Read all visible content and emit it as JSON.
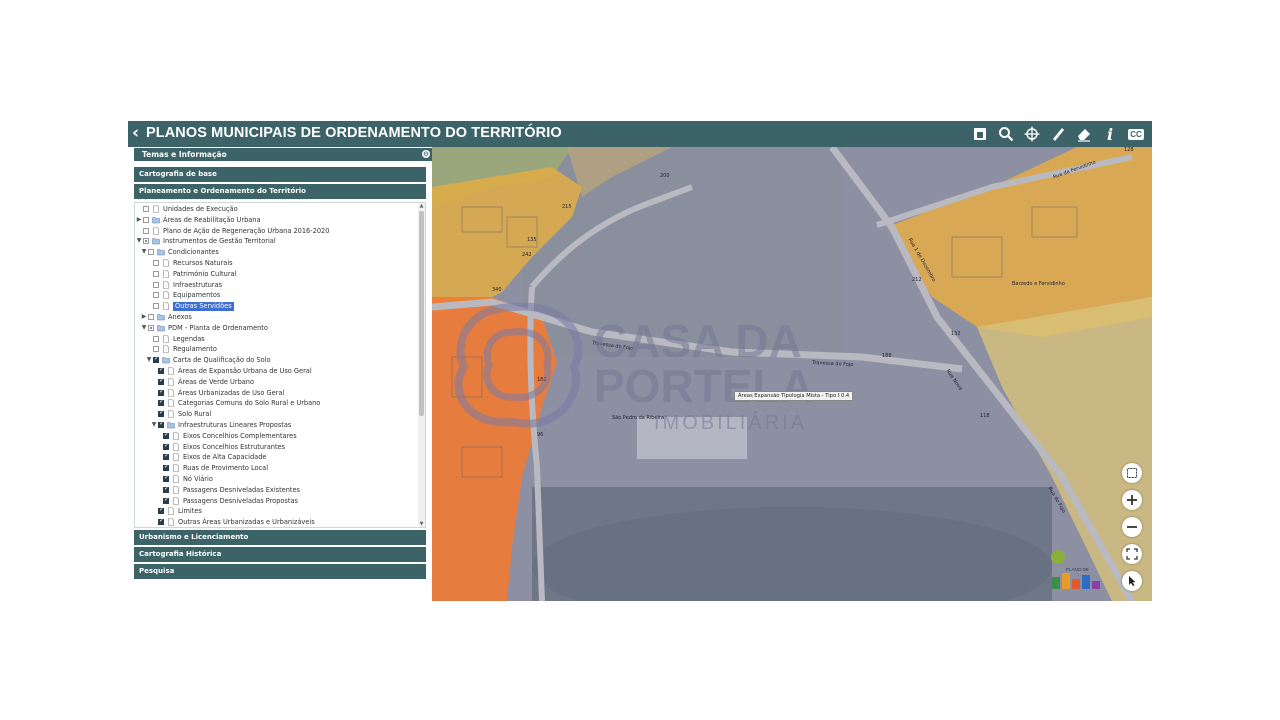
{
  "app": {
    "title": "PLANOS MUNICIPAIS DE ORDENAMENTO DO TERRITÓRIO",
    "back_icon": "chevron-left-icon",
    "accent_color": "#3c6468"
  },
  "toolbar": {
    "tools": [
      {
        "name": "select-area-icon"
      },
      {
        "name": "search-icon"
      },
      {
        "name": "crosshair-icon"
      },
      {
        "name": "measure-ruler-icon"
      },
      {
        "name": "eraser-icon"
      },
      {
        "name": "info-icon",
        "text": "i"
      },
      {
        "name": "cc-icon",
        "text": "CC"
      }
    ]
  },
  "sidebar": {
    "panel_title": "Temas e Informação",
    "sections": {
      "cartografia_base": "Cartografia de base",
      "planeamento": "Planeamento e Ordenamento do Território",
      "urbanismo": "Urbanismo e Licenciamento",
      "historica": "Cartografia Histórica",
      "pesquisa": "Pesquisa"
    },
    "tree": [
      {
        "label": "Unidades de Execução",
        "level": 0,
        "expander": "",
        "check": "off",
        "icon": "file"
      },
      {
        "label": "Áreas de Reabilitação Urbana",
        "level": 0,
        "expander": "▶",
        "check": "off",
        "icon": "folder"
      },
      {
        "label": "Plano de Ação de Regeneração Urbana 2016-2020",
        "level": 0,
        "expander": "",
        "check": "off",
        "icon": "file"
      },
      {
        "label": "Instrumentos de Gestão Territorial",
        "level": 0,
        "expander": "▼",
        "check": "part",
        "icon": "folder"
      },
      {
        "label": "Condicionantes",
        "level": 1,
        "expander": "▼",
        "check": "off",
        "icon": "folder"
      },
      {
        "label": "Recursos Naturais",
        "level": 2,
        "expander": "",
        "check": "off",
        "icon": "file"
      },
      {
        "label": "Património Cultural",
        "level": 2,
        "expander": "",
        "check": "off",
        "icon": "file"
      },
      {
        "label": "Infraestruturas",
        "level": 2,
        "expander": "",
        "check": "off",
        "icon": "file"
      },
      {
        "label": "Equipamentos",
        "level": 2,
        "expander": "",
        "check": "off",
        "icon": "file"
      },
      {
        "label": "Outras Servidões",
        "level": 2,
        "expander": "",
        "check": "off",
        "icon": "file",
        "selected": true
      },
      {
        "label": "Anexos",
        "level": 1,
        "expander": "▶",
        "check": "off",
        "icon": "folder"
      },
      {
        "label": "PDM - Planta de Ordenamento",
        "level": 1,
        "expander": "▼",
        "check": "part",
        "icon": "folder"
      },
      {
        "label": "Legendas",
        "level": 2,
        "expander": "",
        "check": "off",
        "icon": "file"
      },
      {
        "label": "Regulamento",
        "level": 2,
        "expander": "",
        "check": "off",
        "icon": "file"
      },
      {
        "label": "Carta de Qualificação do Solo",
        "level": 2,
        "expander": "▼",
        "check": "on",
        "icon": "folder"
      },
      {
        "label": "Áreas de Expansão Urbana de Uso Geral",
        "level": 3,
        "expander": "",
        "check": "on",
        "icon": "file"
      },
      {
        "label": "Áreas de Verde Urbano",
        "level": 3,
        "expander": "",
        "check": "on",
        "icon": "file"
      },
      {
        "label": "Áreas Urbanizadas de Uso Geral",
        "level": 3,
        "expander": "",
        "check": "on",
        "icon": "file"
      },
      {
        "label": "Categorias Comuns do Solo Rural e Urbano",
        "level": 3,
        "expander": "",
        "check": "on",
        "icon": "file"
      },
      {
        "label": "Solo Rural",
        "level": 3,
        "expander": "",
        "check": "on",
        "icon": "file"
      },
      {
        "label": "Infraestruturas Lineares Propostas",
        "level": 3,
        "expander": "▼",
        "check": "on",
        "icon": "folder"
      },
      {
        "label": "Eixos Concelhios Complementares",
        "level": 4,
        "expander": "",
        "check": "on",
        "icon": "file"
      },
      {
        "label": "Eixos Concelhios Estruturantes",
        "level": 4,
        "expander": "",
        "check": "on",
        "icon": "file"
      },
      {
        "label": "Eixos de Alta Capacidade",
        "level": 4,
        "expander": "",
        "check": "on",
        "icon": "file"
      },
      {
        "label": "Ruas de Provimento Local",
        "level": 4,
        "expander": "",
        "check": "on",
        "icon": "file"
      },
      {
        "label": "Nó Viário",
        "level": 4,
        "expander": "",
        "check": "on",
        "icon": "file"
      },
      {
        "label": "Passagens Desniveladas Existentes",
        "level": 4,
        "expander": "",
        "check": "on",
        "icon": "file"
      },
      {
        "label": "Passagens Desniveladas Propostas",
        "level": 4,
        "expander": "",
        "check": "on",
        "icon": "file"
      },
      {
        "label": "Limites",
        "level": 3,
        "expander": "",
        "check": "on",
        "icon": "file"
      },
      {
        "label": "Outras Áreas Urbanizadas e Urbanizáveis",
        "level": 3,
        "expander": "",
        "check": "on",
        "icon": "file"
      }
    ]
  },
  "map": {
    "popup": "Áreas Expansão Tipologia Mista - Tipo I 0.4",
    "place_label": "Barzedo e Fervidinho",
    "school_label": "São Pedro da Ribeira",
    "street_labels": [
      "Travessa do Fojo",
      "Travessa do Fojo",
      "Rua 1 de Dezembro",
      "Rua de Fervidinho",
      "Rua Nova",
      "Rua do Fojo"
    ],
    "parcel_numbers": [
      "200",
      "188",
      "212",
      "340",
      "128",
      "132",
      "135",
      "118",
      "215",
      "242",
      "182",
      "96"
    ],
    "watermark": {
      "line1": "CASA DA",
      "line2": "PORTELA",
      "line3": "IMOBILIÁRIA"
    },
    "controls": [
      "select-box-icon",
      "zoom-in-icon",
      "zoom-out-icon",
      "fullscreen-icon",
      "pointer-icon"
    ],
    "logo_text": "PLANO DE"
  }
}
